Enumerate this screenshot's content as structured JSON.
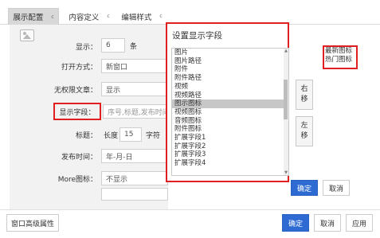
{
  "tabs": [
    {
      "label": "展示配置",
      "icon": "c"
    },
    {
      "label": "内容定义",
      "icon": "c"
    },
    {
      "label": "编辑样式",
      "icon": "c"
    }
  ],
  "form": {
    "count_label": "显示：",
    "count_value": "6",
    "count_unit": "条",
    "open_label": "打开方式：",
    "open_value": "新窗口",
    "empty_label": "无权限文章：",
    "empty_value": "显示",
    "fields_label": "显示字段：",
    "fields_placeholder": "序号,标题,发布时间",
    "title_label": "标题：",
    "title_len_label": "长度",
    "title_len_value": "15",
    "title_len_unit": "字符",
    "date_label": "发布时间：",
    "date_value": "年-月-日",
    "more_label": "More图标：",
    "more_value": "不显示"
  },
  "dialog": {
    "title": "设置显示字段",
    "list": [
      "图片",
      "图片路径",
      "附件",
      "附件路径",
      "视频",
      "视频路径",
      "图示图标",
      "视频图标",
      "音频图标",
      "附件图标",
      "扩展字段1",
      "扩展字段2",
      "扩展字段3",
      "扩展字段4"
    ],
    "selected": "图示图标",
    "move_right": [
      "右",
      "移"
    ],
    "move_left": [
      "左",
      "移"
    ],
    "chosen": [
      "最新图标",
      "热门图标"
    ],
    "ok": "确定",
    "cancel": "取消"
  },
  "footer": {
    "advanced": "窗口高级属性",
    "ok": "确定",
    "cancel": "取消",
    "apply": "应用"
  },
  "colors": {
    "accent": "#2d6bd3",
    "highlight": "#e02020",
    "selected_item": "#c7c7c7"
  }
}
